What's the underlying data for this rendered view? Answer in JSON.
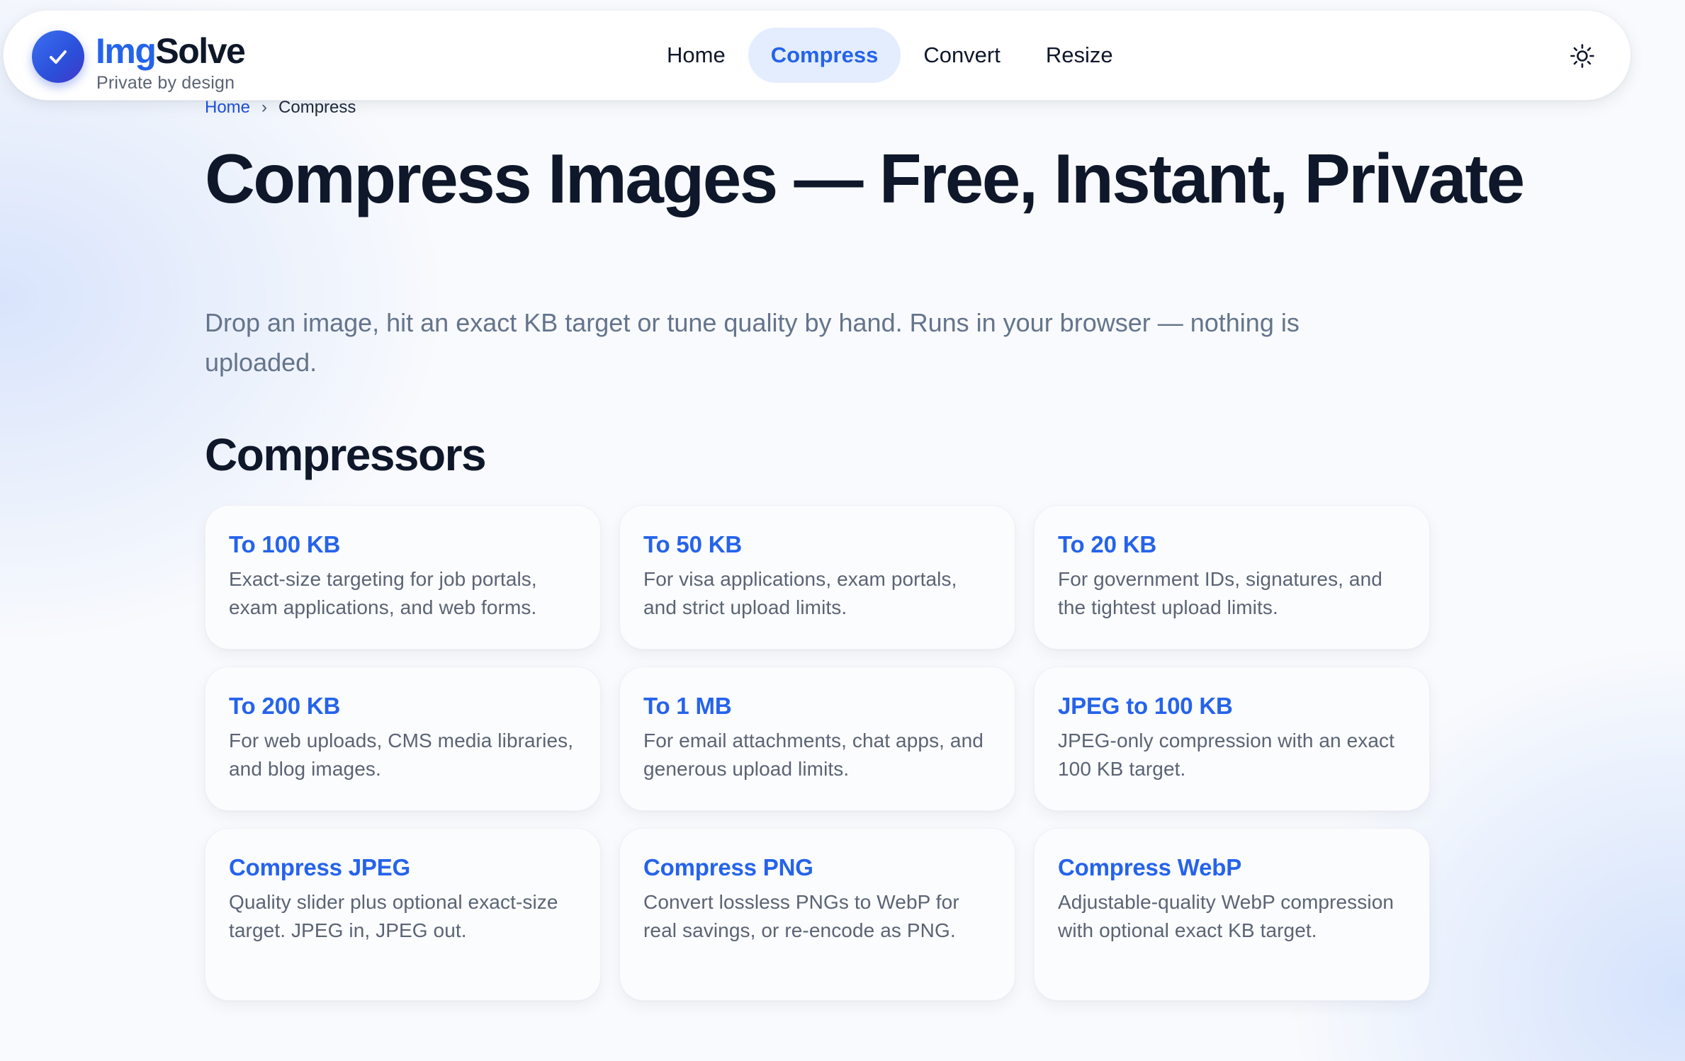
{
  "header": {
    "brand_part1": "Img",
    "brand_part2": "Solve",
    "tagline": "Private by design",
    "nav": [
      {
        "label": "Home"
      },
      {
        "label": "Compress",
        "active": true
      },
      {
        "label": "Convert"
      },
      {
        "label": "Resize"
      }
    ],
    "theme_icon": "sun-icon",
    "logo_icon": "check-icon"
  },
  "breadcrumb": {
    "home": "Home",
    "separator": "›",
    "current": "Compress"
  },
  "hero": {
    "title": "Compress Images — Free, Instant, Private",
    "subtitle": "Drop an image, hit an exact KB target or tune quality by hand. Runs in your browser — nothing is uploaded."
  },
  "section": {
    "title": "Compressors"
  },
  "cards": [
    {
      "title": "To 100 KB",
      "desc": "Exact-size targeting for job portals, exam applications, and web forms."
    },
    {
      "title": "To 50 KB",
      "desc": "For visa applications, exam portals, and strict upload limits."
    },
    {
      "title": "To 20 KB",
      "desc": "For government IDs, signatures, and the tightest upload limits."
    },
    {
      "title": "To 200 KB",
      "desc": "For web uploads, CMS media libraries, and blog images."
    },
    {
      "title": "To 1 MB",
      "desc": "For email attachments, chat apps, and generous upload limits."
    },
    {
      "title": "JPEG to 100 KB",
      "desc": "JPEG-only compression with an exact 100 KB target."
    },
    {
      "title": "Compress JPEG",
      "desc": "Quality slider plus optional exact-size target. JPEG in, JPEG out."
    },
    {
      "title": "Compress PNG",
      "desc": "Convert lossless PNGs to WebP for real savings, or re-encode as PNG."
    },
    {
      "title": "Compress WebP",
      "desc": "Adjustable-quality WebP compression with optional exact KB target."
    }
  ],
  "colors": {
    "accent": "#2563eb",
    "text": "#0f172a",
    "muted": "#64748b",
    "nav_active_bg": "#e3edfe"
  }
}
